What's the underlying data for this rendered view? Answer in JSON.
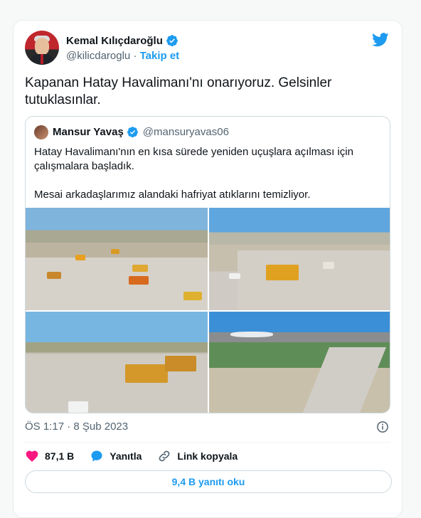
{
  "author": {
    "name": "Kemal Kılıçdaroğlu",
    "handle": "@kilicdaroglu",
    "separator": "·",
    "follow_label": "Takip et"
  },
  "tweet": {
    "text": "Kapanan Hatay Havalimanı'nı onarıyoruz. Gelsinler tutuklasınlar."
  },
  "quoted": {
    "name": "Mansur Yavaş",
    "handle": "@mansuryavas06",
    "paragraph1": "Hatay Havalimanı'nın en kısa sürede yeniden uçuşlara açılması için çalışmalara başladık.",
    "paragraph2": "Mesai arkadaşlarımız alandaki hafriyat atıklarını temizliyor."
  },
  "footer": {
    "timestamp": "ÖS 1:17 · 8 Şub 2023"
  },
  "actions": {
    "likes": "87,1 B",
    "reply": "Yanıtla",
    "copy_link": "Link kopyala"
  },
  "read_replies": "9,4 B yanıtı oku",
  "colors": {
    "accent": "#1d9bf0",
    "like": "#f91880",
    "text": "#0f1419",
    "secondary": "#536471"
  },
  "icons": [
    "verified-icon",
    "twitter-bird-icon",
    "info-icon",
    "heart-icon",
    "reply-icon",
    "link-icon"
  ]
}
